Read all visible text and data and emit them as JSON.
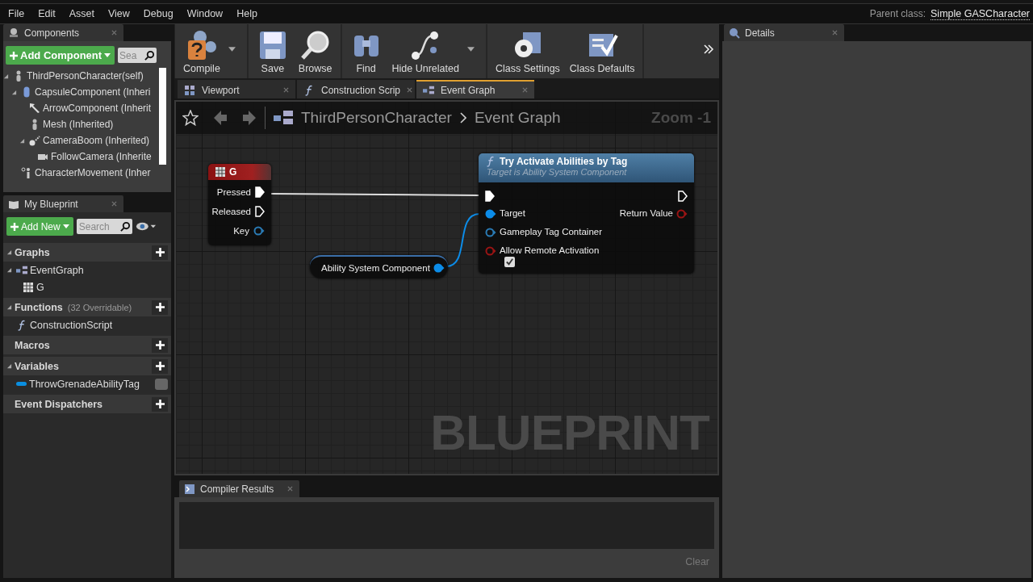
{
  "menu": [
    "File",
    "Edit",
    "Asset",
    "View",
    "Debug",
    "Window",
    "Help"
  ],
  "parent_class": {
    "label": "Parent class:",
    "value": "Simple GASCharacter"
  },
  "components_panel": {
    "title": "Components",
    "add_button": "Add Component",
    "search_placeholder": "Sea",
    "tree": [
      {
        "label": "ThirdPersonCharacter(self)",
        "kind": "figure",
        "children": [
          {
            "label": "CapsuleComponent (Inheri",
            "kind": "capsule",
            "expanded": true,
            "children": [
              {
                "label": "ArrowComponent (Inherit",
                "kind": "arrow"
              },
              {
                "label": "Mesh (Inherited)",
                "kind": "figure"
              },
              {
                "label": "CameraBoom (Inherited)",
                "kind": "boom",
                "expanded": true,
                "children": [
                  {
                    "label": "FollowCamera (Inherite",
                    "kind": "camera"
                  }
                ]
              }
            ]
          },
          {
            "label": "CharacterMovement (Inher",
            "kind": "movement"
          }
        ]
      }
    ]
  },
  "my_blueprint": {
    "title": "My Blueprint",
    "add_button": "Add New",
    "search_placeholder": "Search",
    "sections": [
      {
        "title": "Graphs",
        "expanded": true,
        "items": [
          {
            "label": "EventGraph",
            "kind": "graph",
            "expanded": true,
            "children": [
              {
                "label": "G",
                "kind": "event"
              }
            ]
          }
        ]
      },
      {
        "title": "Functions",
        "note": "(32 Overridable)",
        "expanded": true,
        "items": [
          {
            "label": "ConstructionScript",
            "kind": "function"
          }
        ]
      },
      {
        "title": "Macros"
      },
      {
        "title": "Variables",
        "expanded": true,
        "items": [
          {
            "label": "ThrowGrenadeAbilityTag",
            "kind": "variable",
            "color": "#0a8ee0"
          }
        ]
      },
      {
        "title": "Event Dispatchers"
      }
    ]
  },
  "toolbar": {
    "groups": [
      [
        {
          "label": "Compile",
          "kind": "compile",
          "dropdown": true
        }
      ],
      [
        {
          "label": "Save",
          "kind": "save",
          "dropdown": false
        },
        {
          "label": "Browse",
          "kind": "browse",
          "dropdown": false
        }
      ],
      [
        {
          "label": "Find",
          "kind": "find",
          "dropdown": false
        },
        {
          "label": "Hide Unrelated",
          "kind": "hide",
          "dropdown": true
        }
      ],
      [
        {
          "label": "Class Settings",
          "kind": "settings",
          "dropdown": false
        },
        {
          "label": "Class Defaults",
          "kind": "defaults",
          "dropdown": false
        }
      ]
    ]
  },
  "tabs": [
    {
      "label": "Viewport",
      "kind": "viewport",
      "selected": false
    },
    {
      "label": "Construction Scrip",
      "kind": "function",
      "selected": false
    },
    {
      "label": "Event Graph",
      "kind": "graph",
      "selected": true
    }
  ],
  "graph": {
    "breadcrumb": [
      "ThirdPersonCharacter",
      "Event Graph"
    ],
    "zoom": "Zoom -1",
    "watermark": "BLUEPRINT",
    "event_node": {
      "title": "G",
      "pins": [
        {
          "label": "Pressed",
          "kind": "exec",
          "connected": true
        },
        {
          "label": "Released",
          "kind": "exec",
          "connected": false
        },
        {
          "label": "Key",
          "kind": "struct",
          "connected": false
        }
      ]
    },
    "function_node": {
      "title": "Try Activate Abilities by Tag",
      "subtitle": "Target is Ability System Component",
      "exec_in": {
        "connected": true
      },
      "exec_out": {
        "connected": false
      },
      "inputs": [
        {
          "label": "Target",
          "kind": "object",
          "connected": true
        },
        {
          "label": "Gameplay Tag Container",
          "kind": "struct",
          "connected": false
        },
        {
          "label": "Allow Remote Activation",
          "kind": "bool",
          "connected": false,
          "checked": true
        }
      ],
      "outputs": [
        {
          "label": "Return Value",
          "kind": "bool",
          "connected": false
        }
      ]
    },
    "variable_node": {
      "label": "Ability System Component",
      "kind": "object",
      "connected": true
    }
  },
  "compiler_results": {
    "title": "Compiler Results",
    "clear_button": "Clear"
  },
  "details": {
    "title": "Details"
  }
}
